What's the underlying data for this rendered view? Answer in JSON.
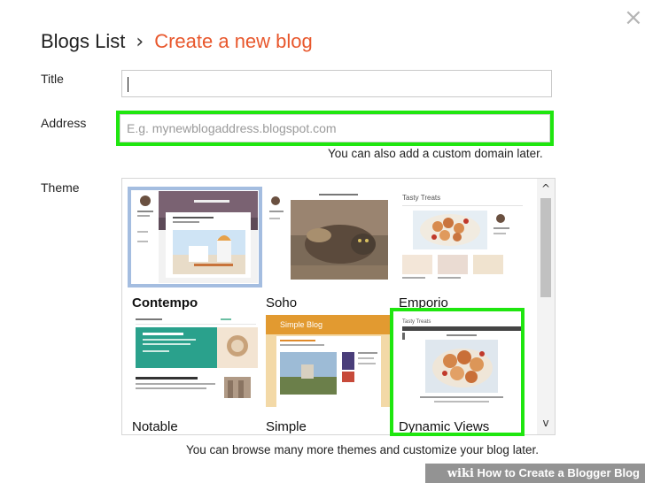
{
  "header": {
    "breadcrumb_parent": "Blogs List",
    "separator": "›",
    "breadcrumb_current": "Create a new blog"
  },
  "close_icon": "×",
  "form": {
    "title_label": "Title",
    "title_value": "",
    "address_label": "Address",
    "address_placeholder": "E.g. mynewblogaddress.blogspot.com",
    "address_hint": "You can also add a custom domain later.",
    "theme_label": "Theme",
    "themes_hint": "You can browse many more themes and customize your blog later."
  },
  "themes": [
    {
      "name": "Contempo",
      "selected": true
    },
    {
      "name": "Soho",
      "selected": false
    },
    {
      "name": "Emporio",
      "selected": false
    },
    {
      "name": "Notable",
      "selected": false
    },
    {
      "name": "Simple",
      "selected": false
    },
    {
      "name": "Dynamic Views",
      "selected": false
    }
  ],
  "scrollbar": {
    "up_icon": "^",
    "down_icon": "v"
  },
  "watermark": {
    "brand": "wiki",
    "text": "How to Create a Blogger Blog"
  },
  "colors": {
    "accent": "#e8572c",
    "highlight": "#1fe60f",
    "selected_border": "#a4bde0"
  }
}
